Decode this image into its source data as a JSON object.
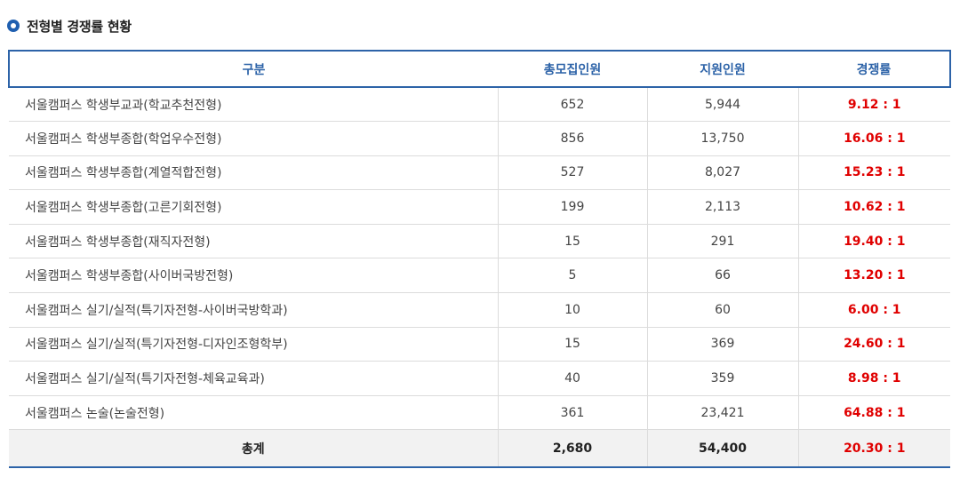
{
  "section_title": "전형별 경쟁률 현황",
  "table": {
    "headers": [
      "구분",
      "총모집인원",
      "지원인원",
      "경쟁률"
    ],
    "rows": [
      {
        "name": "서울캠퍼스 학생부교과(학교추천전형)",
        "quota": "652",
        "applicants": "5,944",
        "rate": "9.12 : 1"
      },
      {
        "name": "서울캠퍼스 학생부종합(학업우수전형)",
        "quota": "856",
        "applicants": "13,750",
        "rate": "16.06 : 1"
      },
      {
        "name": "서울캠퍼스 학생부종합(계열적합전형)",
        "quota": "527",
        "applicants": "8,027",
        "rate": "15.23 : 1"
      },
      {
        "name": "서울캠퍼스 학생부종합(고른기회전형)",
        "quota": "199",
        "applicants": "2,113",
        "rate": "10.62 : 1"
      },
      {
        "name": "서울캠퍼스 학생부종합(재직자전형)",
        "quota": "15",
        "applicants": "291",
        "rate": "19.40 : 1"
      },
      {
        "name": "서울캠퍼스 학생부종합(사이버국방전형)",
        "quota": "5",
        "applicants": "66",
        "rate": "13.20 : 1"
      },
      {
        "name": "서울캠퍼스 실기/실적(특기자전형-사이버국방학과)",
        "quota": "10",
        "applicants": "60",
        "rate": "6.00 : 1"
      },
      {
        "name": "서울캠퍼스 실기/실적(특기자전형-디자인조형학부)",
        "quota": "15",
        "applicants": "369",
        "rate": "24.60 : 1"
      },
      {
        "name": "서울캠퍼스 실기/실적(특기자전형-체육교육과)",
        "quota": "40",
        "applicants": "359",
        "rate": "8.98 : 1"
      },
      {
        "name": "서울캠퍼스 논술(논술전형)",
        "quota": "361",
        "applicants": "23,421",
        "rate": "64.88 : 1"
      }
    ],
    "total": {
      "label": "총계",
      "quota": "2,680",
      "applicants": "54,400",
      "rate": "20.30 : 1"
    }
  },
  "colors": {
    "accent": "#2d63a8",
    "rate_red": "#e00000",
    "total_bg": "#f2f2f2"
  },
  "icons": {
    "title_bullet": "radio-bullet-icon"
  }
}
